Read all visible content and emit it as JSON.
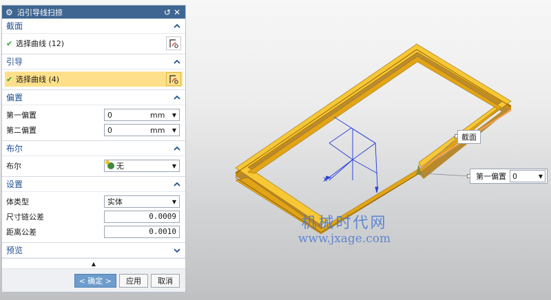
{
  "dialog": {
    "title": "沿引导线扫掠",
    "icons": {
      "settings": "gear-icon",
      "reset": "reset-icon",
      "close": "close-icon"
    }
  },
  "sections": {
    "section_curve": {
      "header": "截面",
      "select_label": "选择曲线 (12)",
      "collapsed": false
    },
    "guide": {
      "header": "引导",
      "select_label": "选择曲线 (4)",
      "collapsed": false
    },
    "offset": {
      "header": "偏置",
      "first_label": "第一偏置",
      "first_value": "0",
      "first_unit": "mm",
      "second_label": "第二偏置",
      "second_value": "0",
      "second_unit": "mm"
    },
    "boolean": {
      "header": "布尔",
      "label": "布尔",
      "value": "无"
    },
    "settings": {
      "header": "设置",
      "body_type_label": "体类型",
      "body_type_value": "实体",
      "chain_tol_label": "尺寸链公差",
      "chain_tol_value": "0.0009",
      "dist_tol_label": "距离公差",
      "dist_tol_value": "0.0010"
    },
    "preview": {
      "header": "预览",
      "collapsed": true
    }
  },
  "buttons": {
    "ok": "< 确定 >",
    "apply": "应用",
    "cancel": "取消"
  },
  "viewport": {
    "callout_section": "截面",
    "callout_offset_label": "第一偏置",
    "callout_offset_value": "0",
    "axis_x": "X",
    "watermark_line1": "机械时代网",
    "watermark_line2": "www.jxage.com"
  },
  "colors": {
    "titlebar": "#3f6591",
    "section_header": "#1f4f8f",
    "selected_row": "#ffe08a",
    "frame_yellow": "#f5b820",
    "guide_orange": "#f7a25a",
    "sketch_blue": "#2c43d8",
    "ok_button": "#6d9ccd",
    "check_green": "#28a33a"
  }
}
